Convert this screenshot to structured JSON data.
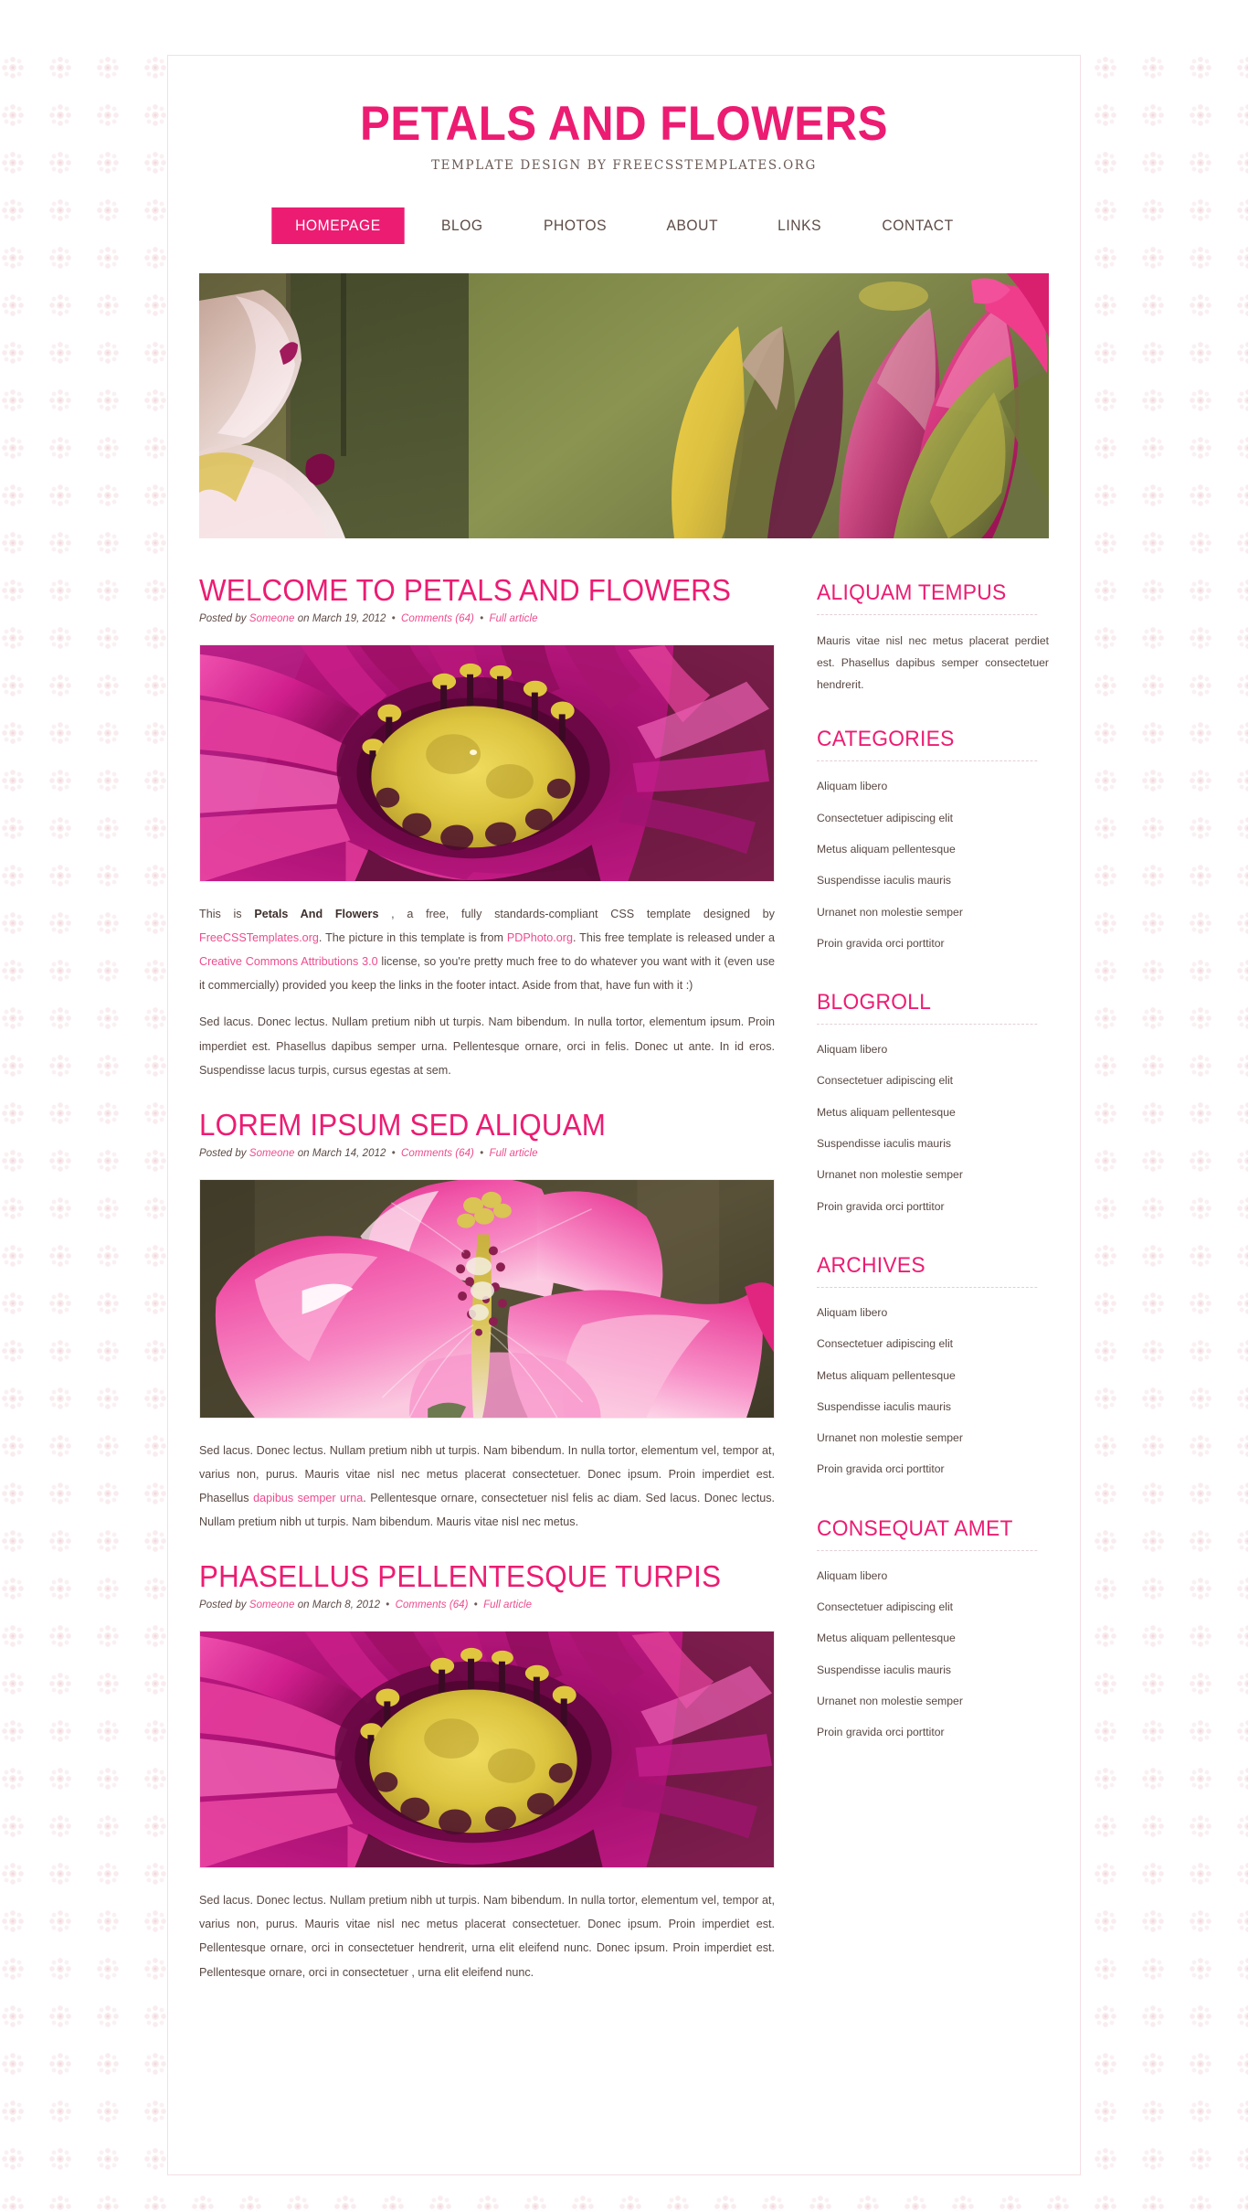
{
  "theme": {
    "accent": "#EC1C72",
    "link": "#ED4C8E",
    "text": "#584843",
    "bg": "#ffffff",
    "pattern": "#edc8d0"
  },
  "header": {
    "title": "PETALS AND FLOWERS",
    "tagline": "TEMPLATE DESIGN BY FREECSSTEMPLATES.ORG"
  },
  "menu": {
    "items": [
      {
        "label": "HOMEPAGE",
        "current": true
      },
      {
        "label": "BLOG",
        "current": false
      },
      {
        "label": "PHOTOS",
        "current": false
      },
      {
        "label": "ABOUT",
        "current": false
      },
      {
        "label": "LINKS",
        "current": false
      },
      {
        "label": "CONTACT",
        "current": false
      }
    ]
  },
  "banner": {
    "alt": "lotus-flower-buds-banner"
  },
  "posts": [
    {
      "title": "WELCOME TO PETALS AND FLOWERS",
      "meta": {
        "posted_by_label": "Posted by",
        "author": "Someone",
        "on_label": "on",
        "date": "March 19, 2012",
        "comments": "Comments (64)",
        "full_article": "Full article"
      },
      "image_alt": "pink-dahlia-closeup",
      "paragraph1_pre": "This is ",
      "paragraph1_strong": "Petals And Flowers",
      "paragraph1_mid1": " , a free, fully standards-compliant CSS template designed by ",
      "paragraph1_link1": "FreeCSSTemplates.org",
      "paragraph1_mid2": ". The picture in this template is from ",
      "paragraph1_link2": "PDPhoto.org",
      "paragraph1_mid3": ". This free template is released under a ",
      "paragraph1_link3": "Creative Commons Attributions 3.0",
      "paragraph1_end": " license, so you're pretty much free to do whatever you want with it (even use it commercially) provided you keep the links in the footer intact. Aside from that, have fun with it :)",
      "paragraph2": "Sed lacus. Donec lectus. Nullam pretium nibh ut turpis. Nam bibendum. In nulla tortor, elementum ipsum. Proin imperdiet est. Phasellus dapibus semper urna. Pellentesque ornare, orci in felis. Donec ut ante. In id eros. Suspendisse lacus turpis, cursus egestas at sem."
    },
    {
      "title": "LOREM IPSUM SED ALIQUAM",
      "meta": {
        "posted_by_label": "Posted by",
        "author": "Someone",
        "on_label": "on",
        "date": "March 14, 2012",
        "comments": "Comments (64)",
        "full_article": "Full article"
      },
      "image_alt": "pink-hibiscus-closeup",
      "paragraph1_pre": "Sed lacus. Donec lectus. Nullam pretium nibh ut turpis. Nam bibendum. In nulla tortor, elementum vel, tempor at, varius non, purus. Mauris vitae nisl nec metus placerat consectetuer. Donec ipsum. Proin imperdiet est. Phasellus ",
      "paragraph1_link1": "dapibus semper urna",
      "paragraph1_end": ". Pellentesque ornare, consectetuer nisl felis ac diam. Sed lacus. Donec lectus. Nullam pretium nibh ut turpis. Nam bibendum. Mauris vitae nisl nec metus."
    },
    {
      "title": "PHASELLUS PELLENTESQUE TURPIS",
      "meta": {
        "posted_by_label": "Posted by",
        "author": "Someone",
        "on_label": "on",
        "date": "March 8, 2012",
        "comments": "Comments (64)",
        "full_article": "Full article"
      },
      "image_alt": "pink-dahlia-closeup-2",
      "paragraph1": "Sed lacus. Donec lectus. Nullam pretium nibh ut turpis. Nam bibendum. In nulla tortor, elementum vel, tempor at, varius non, purus. Mauris vitae nisl nec metus placerat consectetuer. Donec ipsum. Proin imperdiet est. Pellentesque ornare, orci in consectetuer hendrerit, urna elit eleifend nunc. Donec ipsum. Proin imperdiet est. Pellentesque ornare, orci in consectetuer , urna elit eleifend nunc."
    }
  ],
  "sidebar": {
    "boxes": [
      {
        "title": "ALIQUAM TEMPUS",
        "type": "text",
        "text": "Mauris vitae nisl nec metus placerat perdiet est. Phasellus dapibus semper consectetuer hendrerit."
      },
      {
        "title": "CATEGORIES",
        "type": "list",
        "items": [
          "Aliquam libero",
          "Consectetuer adipiscing elit",
          "Metus aliquam pellentesque",
          "Suspendisse iaculis mauris",
          "Urnanet non molestie semper",
          "Proin gravida orci porttitor"
        ]
      },
      {
        "title": "BLOGROLL",
        "type": "list",
        "items": [
          "Aliquam libero",
          "Consectetuer adipiscing elit",
          "Metus aliquam pellentesque",
          "Suspendisse iaculis mauris",
          "Urnanet non molestie semper",
          "Proin gravida orci porttitor"
        ]
      },
      {
        "title": "ARCHIVES",
        "type": "list",
        "items": [
          "Aliquam libero",
          "Consectetuer adipiscing elit",
          "Metus aliquam pellentesque",
          "Suspendisse iaculis mauris",
          "Urnanet non molestie semper",
          "Proin gravida orci porttitor"
        ]
      },
      {
        "title": "CONSEQUAT AMET",
        "type": "list",
        "items": [
          "Aliquam libero",
          "Consectetuer adipiscing elit",
          "Metus aliquam pellentesque",
          "Suspendisse iaculis mauris",
          "Urnanet non molestie semper",
          "Proin gravida orci porttitor"
        ]
      }
    ]
  }
}
